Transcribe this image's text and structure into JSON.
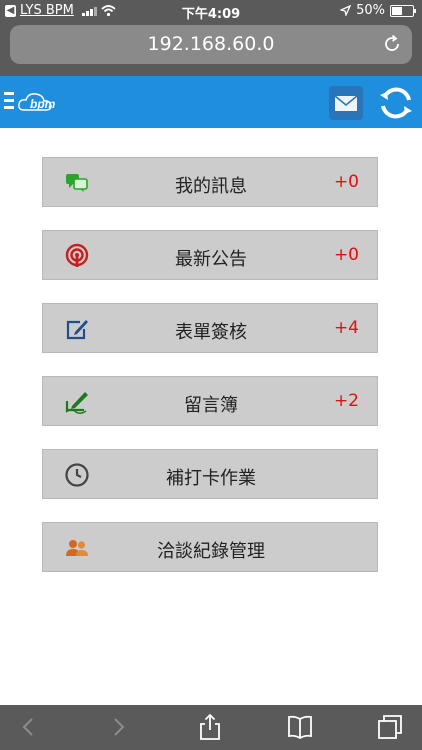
{
  "status_bar": {
    "back_app": "LYS BPM",
    "time": "下午4:09",
    "battery": "50%",
    "battery_level": 0.5
  },
  "browser": {
    "url": "192.168.60.0"
  },
  "app": {
    "logo_text": "bpm"
  },
  "menu": [
    {
      "label": "我的訊息",
      "count": "+0",
      "icon": "chat-bubbles-icon"
    },
    {
      "label": "最新公告",
      "count": "+0",
      "icon": "broadcast-icon"
    },
    {
      "label": "表單簽核",
      "count": "+4",
      "icon": "edit-form-icon"
    },
    {
      "label": "留言簿",
      "count": "+2",
      "icon": "pen-signature-icon"
    },
    {
      "label": "補打卡作業",
      "count": "",
      "icon": "clock-icon"
    },
    {
      "label": "洽談紀錄管理",
      "count": "",
      "icon": "people-icon"
    }
  ],
  "colors": {
    "header": "#1f8fdd",
    "count": "#e01010",
    "card": "#cccccc"
  }
}
